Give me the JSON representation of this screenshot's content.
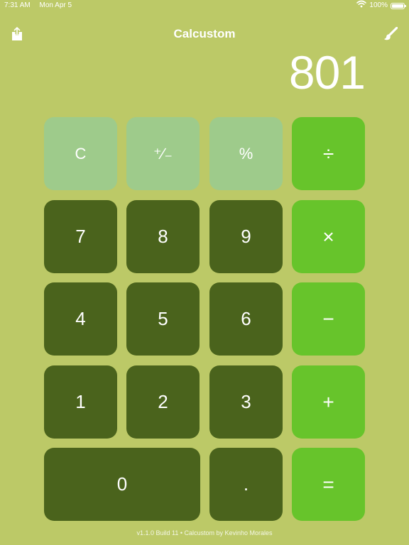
{
  "status_bar": {
    "time": "7:31 AM",
    "date": "Mon Apr 5",
    "battery_percent": "100%",
    "battery_level": 1.0,
    "wifi_icon": "wifi-icon",
    "battery_icon": "battery-icon"
  },
  "nav": {
    "title": "Calcustom",
    "share_icon": "share-icon",
    "theme_icon": "paintbrush-icon"
  },
  "display": {
    "value": "801"
  },
  "keys": {
    "clear": "C",
    "plus_minus": "⁺∕₋",
    "percent": "%",
    "divide": "÷",
    "seven": "7",
    "eight": "8",
    "nine": "9",
    "multiply": "×",
    "four": "4",
    "five": "5",
    "six": "6",
    "minus": "−",
    "one": "1",
    "two": "2",
    "three": "3",
    "plus": "+",
    "zero": "0",
    "decimal": ".",
    "equals": "="
  },
  "footer": {
    "text": "v1.1.0 Build 11 • Calcustom by Kevinho Morales"
  },
  "colors": {
    "background": "#bcc967",
    "function_key": "#9ecb8b",
    "number_key": "#4a631c",
    "operator_key": "#67c42b",
    "text": "#ffffff"
  }
}
